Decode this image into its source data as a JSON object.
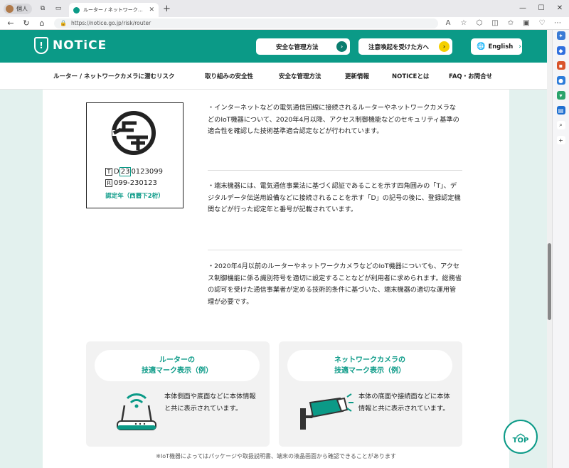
{
  "browser": {
    "profile_label": "個人",
    "tab_title": "ルーター / ネットワークカメラに関する脅威",
    "url": "https://notice.go.jp/risk/router"
  },
  "header": {
    "logo_text": "NOTiCE",
    "btn_manage": "安全な管理方法",
    "btn_alert": "注意喚起を受けた方へ",
    "btn_lang": "English",
    "accent": "#0b9a87",
    "alert_color": "#f5d000"
  },
  "nav": [
    "ルーター / ネットワークカメラに潜むリスク",
    "取り組みの安全性",
    "安全な管理方法",
    "更新情報",
    "NOTICEとは",
    "FAQ・お問合せ"
  ],
  "mark": {
    "line1_prefix": "T",
    "line1_d": "D",
    "line1_year": "23",
    "line1_rest": "0123099",
    "line2_prefix": "R",
    "line2_text": "099-230123",
    "caption": "認定年（西暦下2桁）"
  },
  "paragraphs": [
    "・インターネットなどの電気通信回線に接続されるルーターやネットワークカメラなどのIoT機器について、2020年4月以降、アクセス制御機能などのセキュリティ基準の適合性を確認した技術基準適合認定などが行われています。",
    "・端末機器には、電気通信事業法に基づく認証であることを示す四角囲みの「T」、デジタルデータ伝送用設備などに接続されることを示す「D」の記号の後に、登録認定機関などが行った認定年と番号が記載されています。",
    "・2020年4月以前のルーターやネットワークカメラなどのIoT機器についても、アクセス制御機能に係る識別符号を適切に設定することなどが利用者に求められます。総務省の認可を受けた通信事業者が定める技術的条件に基づいた、端末機器の適切な運用管理が必要です。"
  ],
  "cards": [
    {
      "title_1": "ルーターの",
      "title_2": "技適マーク表示（例）",
      "text": "本体側面や底面などに本体情報と共に表示されています。"
    },
    {
      "title_1": "ネットワークカメラの",
      "title_2": "技適マーク表示（例）",
      "text": "本体の底面や接続面などに本体情報と共に表示されています。"
    }
  ],
  "note": "※IoT機器によってはパッケージや取扱説明書、端末の液晶画面から確認できることがあります",
  "top_label": "TOP"
}
